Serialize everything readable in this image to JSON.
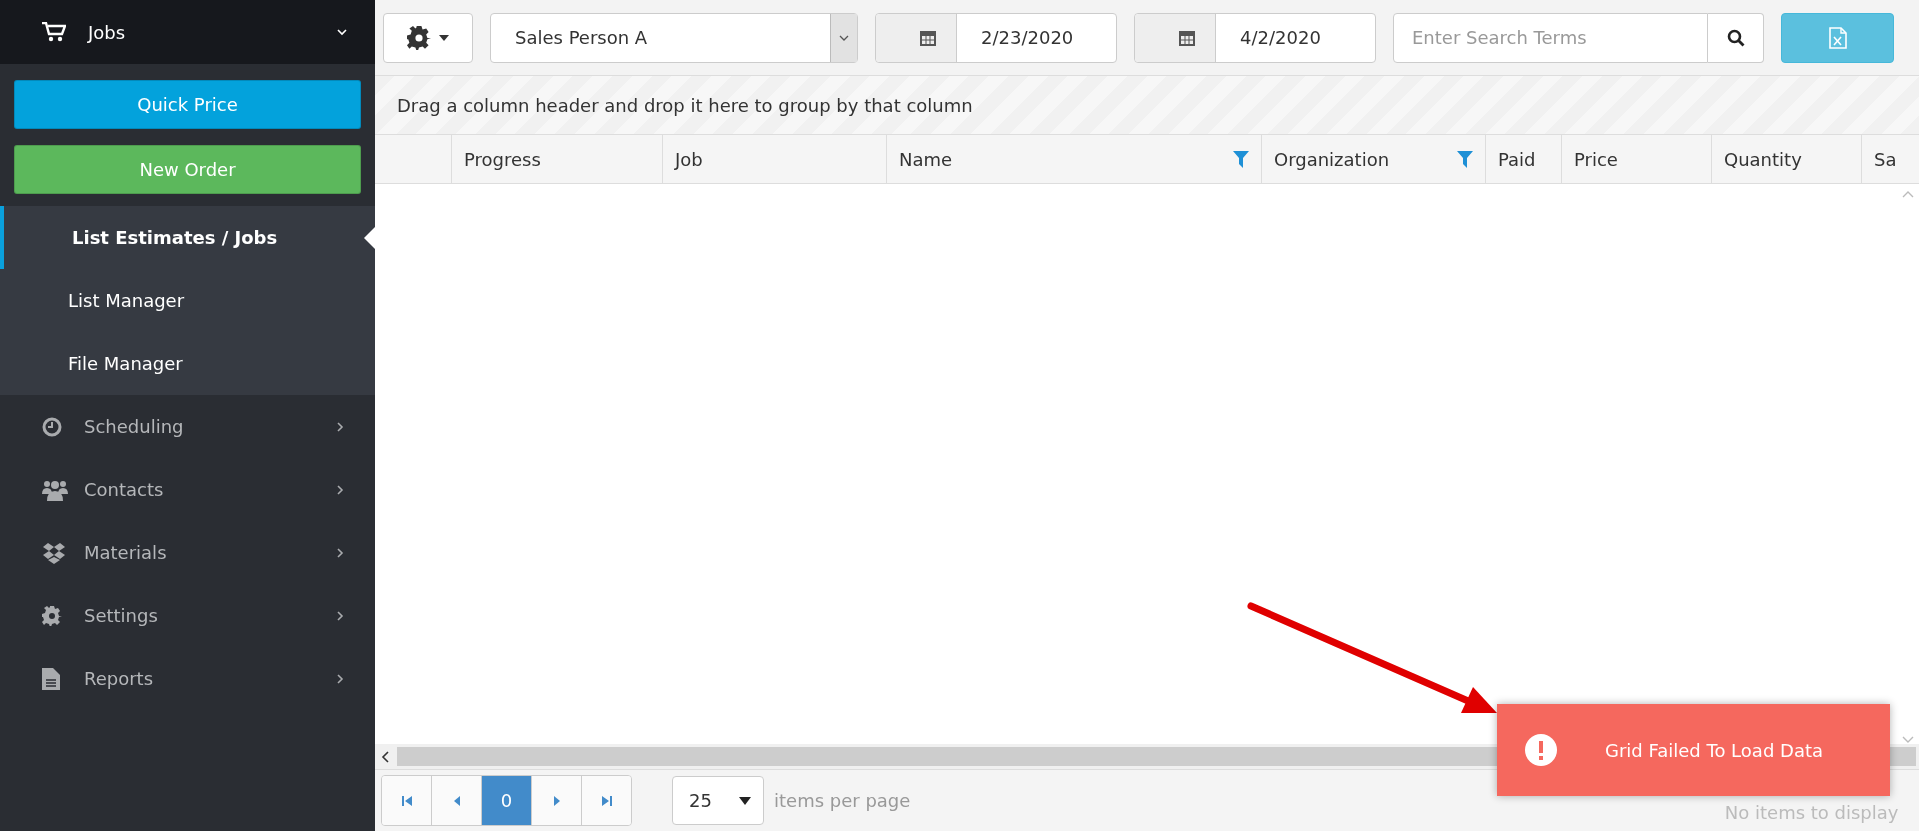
{
  "sidebar": {
    "header": {
      "label": "Jobs",
      "expanded": true
    },
    "buttons": [
      {
        "label": "Quick Price",
        "kind": "primary"
      },
      {
        "label": "New Order",
        "kind": "success"
      }
    ],
    "submenu": [
      {
        "label": "List Estimates / Jobs",
        "selected": true
      },
      {
        "label": "List Manager",
        "selected": false
      },
      {
        "label": "File Manager",
        "selected": false
      }
    ],
    "menu": [
      {
        "label": "Scheduling"
      },
      {
        "label": "Contacts"
      },
      {
        "label": "Materials"
      },
      {
        "label": "Settings"
      },
      {
        "label": "Reports"
      }
    ]
  },
  "toolbar": {
    "sales_person": "Sales Person A",
    "date_from": "2/23/2020",
    "date_to": "4/2/2020",
    "search": {
      "placeholder": "Enter Search Terms"
    }
  },
  "grid": {
    "group_panel": "Drag a column header and drop it here to group by that column",
    "columns": [
      {
        "label": "Progress",
        "filterable": false
      },
      {
        "label": "Job",
        "filterable": false
      },
      {
        "label": "Name",
        "filterable": true
      },
      {
        "label": "Organization",
        "filterable": true
      },
      {
        "label": "Paid",
        "filterable": false
      },
      {
        "label": "Price",
        "filterable": false
      },
      {
        "label": "Quantity",
        "filterable": false
      },
      {
        "label": "Sa",
        "filterable": false
      }
    ]
  },
  "pager": {
    "pages": [
      {
        "label": "0",
        "selected": true
      }
    ],
    "page_size": "25",
    "page_size_label": "items per page",
    "status": "No items to display"
  },
  "toast": {
    "message": "Grid Failed To Load Data"
  }
}
